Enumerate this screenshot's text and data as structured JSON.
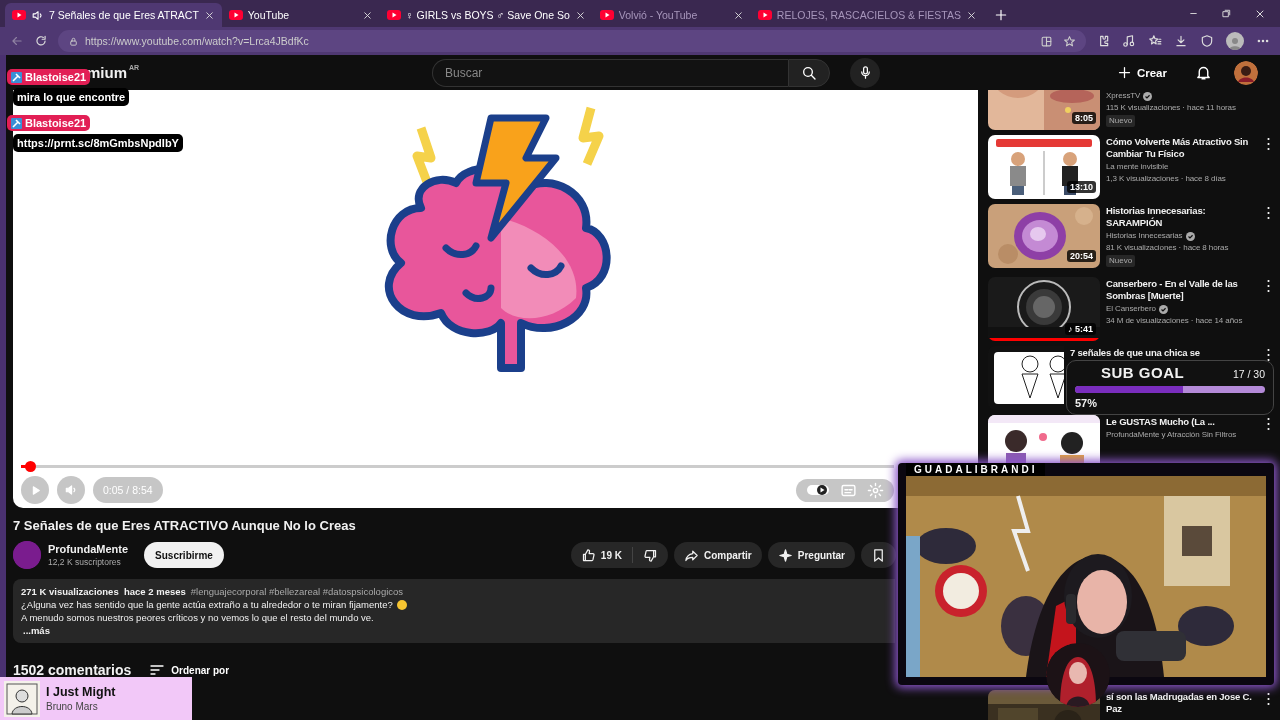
{
  "browser": {
    "tabs": [
      {
        "title": "7 Señales de que Eres ATRACT",
        "selected": true,
        "audio": true,
        "sleeping": false
      },
      {
        "title": "YouTube",
        "selected": false,
        "audio": false,
        "sleeping": false
      },
      {
        "title": "♀ GIRLS vs BOYS ♂ Save One So",
        "selected": false,
        "audio": false,
        "sleeping": false
      },
      {
        "title": "Volvió - YouTube",
        "selected": false,
        "audio": false,
        "sleeping": true
      },
      {
        "title": "RELOJES, RASCACIELOS & FIESTAS",
        "selected": false,
        "audio": false,
        "sleeping": true
      }
    ],
    "url": "https://www.youtube.com/watch?v=Lrca4JBdfKc"
  },
  "masthead": {
    "logo_text": "mium",
    "region": "AR",
    "search": {
      "placeholder": "Buscar"
    },
    "create_label": "Crear"
  },
  "player": {
    "level": 0.01,
    "time": "0:05 / 8:54"
  },
  "video": {
    "title": "7 Señales de que Eres ATRACTIVO Aunque No lo Creas",
    "channel": "ProfundaMente",
    "subscribers": "12,2 K suscriptores",
    "subscribe_label": "Suscribirme",
    "likes": "19 K",
    "share_label": "Compartir",
    "ask_label": "Preguntar",
    "description": {
      "stats": "271 K visualizaciones  hace 2 meses",
      "hashtags": "#lenguajecorporal #bellezareal #datospsicologicos",
      "lines": [
        "¿Alguna vez has sentido que la gente actúa extraño a tu alrededor o te miran fijamente?",
        "A menudo somos nuestros peores críticos y no vemos lo que el resto del mundo ve."
      ],
      "more": "...más"
    }
  },
  "comments": {
    "count": "1502 comentarios",
    "sort_label": "Ordenar por"
  },
  "sidebar": {
    "items": [
      {
        "channel": "XpressTV",
        "verified": true,
        "meta": "115 K visualizaciones · hace 11 horas",
        "badge": "Nuevo",
        "duration": "8:05"
      },
      {
        "title": "Cómo Volverte Más Atractivo Sin Cambiar Tu Físico",
        "channel": "La mente invisible",
        "verified": false,
        "meta": "1,3 K visualizaciones · hace 8 días",
        "duration": "13:10"
      },
      {
        "title": "Historias Innecesarias: SARAMPIÓN",
        "channel": "Historias Innecesarias",
        "verified": true,
        "meta": "81 K visualizaciones · hace 8 horas",
        "badge": "Nuevo",
        "duration": "20:54"
      },
      {
        "title": "Canserbero - En el Valle de las Sombras [Muerte]",
        "channel": "El Canserbero",
        "verified": true,
        "meta": "34 M de visualizaciones · hace 14 años",
        "duration": "♪ 5:41",
        "level": 1
      },
      {
        "title": "7 señales de que una chica se"
      },
      {
        "title": "Le GUSTAS Mucho (La ...",
        "channel": "ProfundaMente y Atracción Sin Filtros",
        "verified": false
      },
      {
        "title": "sí son las Madrugadas en Jose C. Paz"
      }
    ]
  },
  "overlays": {
    "chat": [
      {
        "user": "Blastoise21",
        "message": "mira lo que encontre"
      },
      {
        "user": "Blastoise21",
        "message": "https://prnt.sc/8mGmbsNpdIbY"
      }
    ],
    "sub_goal": {
      "title": "SUB GOAL",
      "count": "17 / 30",
      "level": 0.57,
      "percent": "57%"
    },
    "webcam": {
      "name": "GUADALIBRANDI"
    },
    "now_playing": {
      "title": "I Just Might",
      "artist": "Bruno Mars"
    }
  }
}
